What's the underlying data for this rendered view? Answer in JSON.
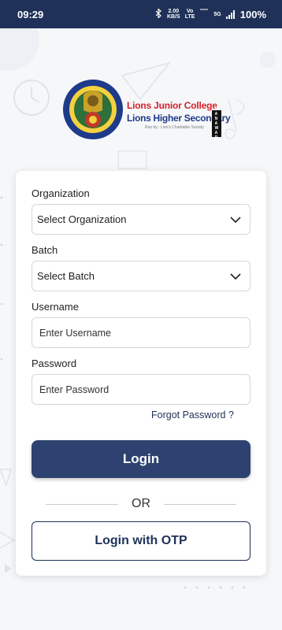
{
  "status_bar": {
    "time": "09:29",
    "net_speed_value": "2.00",
    "net_speed_unit": "KB/S",
    "volte": "Vo\nLTE",
    "network": "5G",
    "battery": "100%"
  },
  "logo": {
    "line1": "Lions Junior College",
    "line2": "Lions Higher Secondary",
    "line3": "Run by : Lion's Charitable Society",
    "vertical": "MANAWAR",
    "icon_name": "school-emblem-icon"
  },
  "form": {
    "organization_label": "Organization",
    "organization_value": "Select Organization",
    "batch_label": "Batch",
    "batch_value": "Select Batch",
    "username_label": "Username",
    "username_placeholder": "Enter Username",
    "password_label": "Password",
    "password_placeholder": "Enter Password",
    "forgot_password": "Forgot Password ?",
    "login_button": "Login",
    "or_text": "OR",
    "otp_button": "Login with OTP"
  },
  "colors": {
    "primary": "#2d4270",
    "status_bar": "#1f3158",
    "card": "#ffffff",
    "background": "#f6f7f9"
  }
}
